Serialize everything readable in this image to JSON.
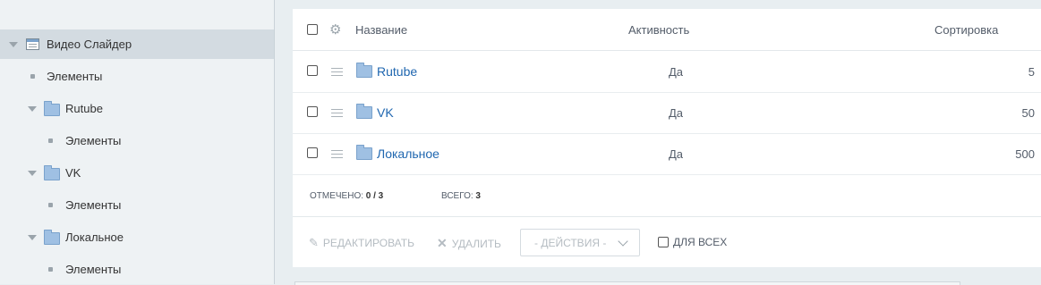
{
  "sidebar": {
    "items": [
      {
        "label": "Видео Слайдер"
      },
      {
        "label": "Элементы"
      },
      {
        "label": "Rutube"
      },
      {
        "label": "Элементы"
      },
      {
        "label": "VK"
      },
      {
        "label": "Элементы"
      },
      {
        "label": "Локальное"
      },
      {
        "label": "Элементы"
      }
    ]
  },
  "table": {
    "columns": {
      "name": "Название",
      "active": "Активность",
      "sort": "Сортировка"
    },
    "rows": [
      {
        "name": "Rutube",
        "active": "Да",
        "sort": "5"
      },
      {
        "name": "VK",
        "active": "Да",
        "sort": "50"
      },
      {
        "name": "Локальное",
        "active": "Да",
        "sort": "500"
      }
    ]
  },
  "stats": {
    "checked_label": "ОТМЕЧЕНО:",
    "checked_value": "0 / 3",
    "total_label": "ВСЕГО:",
    "total_value": "3"
  },
  "actions": {
    "edit": "РЕДАКТИРОВАТЬ",
    "delete": "УДАЛИТЬ",
    "dropdown": "- ДЕЙСТВИЯ -",
    "for_all": "ДЛЯ ВСЕХ"
  },
  "icons": {
    "settings": "gear-icon",
    "edit": "pencil-icon",
    "delete": "close-icon",
    "folder": "folder-icon",
    "drag": "drag-handle-icon"
  },
  "colors": {
    "link": "#2067b0",
    "selected_row": "#d3dbe1",
    "folder": "#9fc0e3"
  }
}
